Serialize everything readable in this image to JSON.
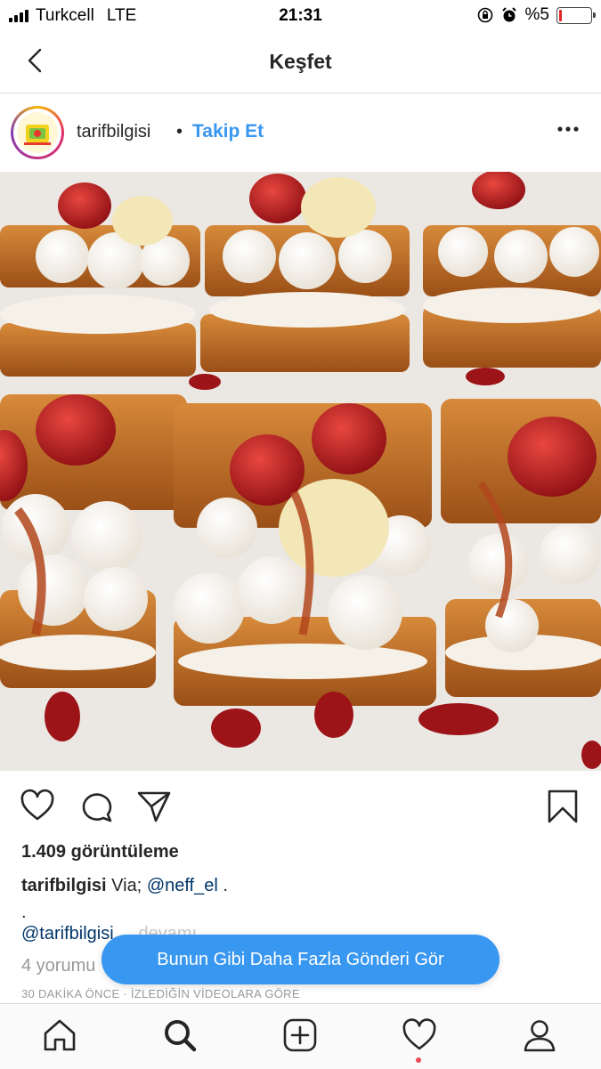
{
  "status_bar": {
    "carrier": "Turkcell",
    "network": "LTE",
    "time": "21:31",
    "battery_text": "%5",
    "battery_level": 0.05,
    "battery_color": "#e0262b"
  },
  "header": {
    "back_icon": "chevron-left-icon",
    "title": "Keşfet"
  },
  "post": {
    "username": "tarifbilgisi",
    "separator": "•",
    "follow_label": "Takip Et",
    "more_icon": "ellipsis-icon",
    "image_description_icon": "dessert-photo"
  },
  "actions": {
    "like_icon": "heart-icon",
    "comment_icon": "comment-icon",
    "share_icon": "paper-plane-icon",
    "save_icon": "bookmark-icon"
  },
  "meta": {
    "views": "1.409 görüntüleme",
    "caption_user": "tarifbilgisi",
    "caption_text": "Via;",
    "caption_mention": "@neff_el",
    "caption_end": ".",
    "caption_dot": ".",
    "caption_mention2": "@tarifbilgisi",
    "more_label": "... devamı",
    "comments": "4 yorumu",
    "timestamp": "30 DAKİKA ÖNCE · İZLEDİĞİN VİDEOLARA GÖRE"
  },
  "toast": {
    "label": "Bunun Gibi Daha Fazla Gönderi Gör"
  },
  "tabbar": {
    "items": [
      "home-icon",
      "search-icon",
      "add-icon",
      "activity-icon",
      "profile-icon"
    ],
    "active": "search-icon"
  },
  "colors": {
    "accent": "#3897f0",
    "link": "#003569",
    "notification": "#ed4956"
  }
}
